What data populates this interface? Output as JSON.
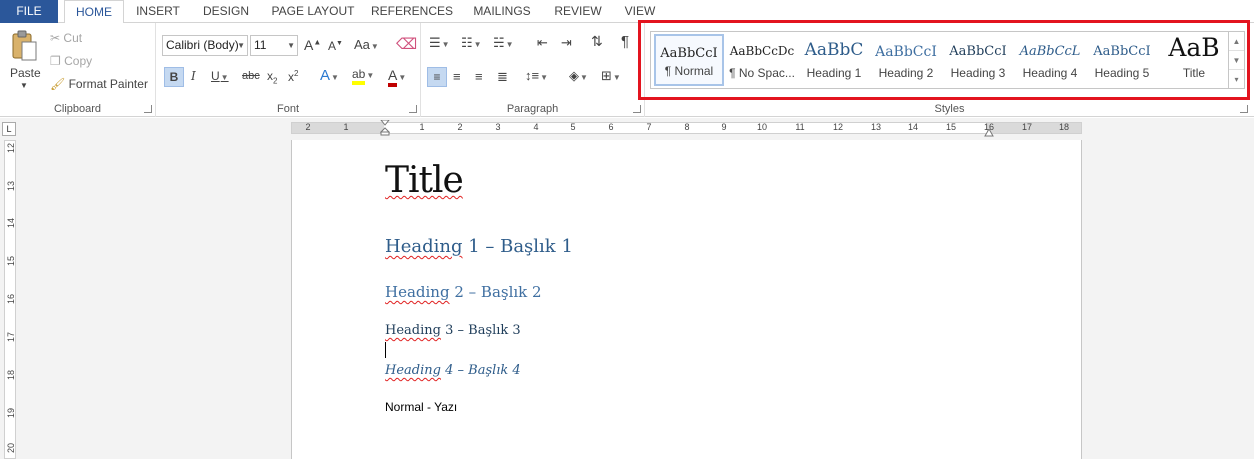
{
  "tabs": [
    {
      "label": "FILE"
    },
    {
      "label": "HOME"
    },
    {
      "label": "INSERT"
    },
    {
      "label": "DESIGN"
    },
    {
      "label": "PAGE LAYOUT"
    },
    {
      "label": "REFERENCES"
    },
    {
      "label": "MAILINGS"
    },
    {
      "label": "REVIEW"
    },
    {
      "label": "VIEW"
    }
  ],
  "clipboard": {
    "label": "Clipboard",
    "paste": "Paste",
    "cut": "Cut",
    "copy": "Copy",
    "format_painter": "Format Painter"
  },
  "font": {
    "label": "Font",
    "family": "Calibri (Body)",
    "size": "11",
    "grow": "A",
    "shrink": "A",
    "change_case": "Aa",
    "bold": "B",
    "italic": "I",
    "underline": "U",
    "strike": "abc",
    "subscript": "x",
    "superscript": "x",
    "effects": "A",
    "highlight": "ab",
    "color": "A",
    "color_hex": "#c00000",
    "highlight_hex": "#ffff00"
  },
  "paragraph": {
    "label": "Paragraph",
    "pilcrow": "¶"
  },
  "styles": {
    "label": "Styles",
    "items": [
      {
        "preview": "AaBbCcI",
        "name": "¶ Normal"
      },
      {
        "preview": "AaBbCcDc",
        "name": "¶ No Spac..."
      },
      {
        "preview": "AaBbC",
        "name": "Heading 1"
      },
      {
        "preview": "AaBbCcI",
        "name": "Heading 2"
      },
      {
        "preview": "AaBbCcI",
        "name": "Heading 3"
      },
      {
        "preview": "AaBbCcL",
        "name": "Heading 4"
      },
      {
        "preview": "AaBbCcI",
        "name": "Heading 5"
      },
      {
        "preview": "AaB",
        "name": "Title"
      }
    ]
  },
  "ruler": {
    "h_labels": [
      "2",
      "1",
      "1",
      "2",
      "3",
      "4",
      "5",
      "6",
      "7",
      "8",
      "9",
      "10",
      "11",
      "12",
      "13",
      "14",
      "15",
      "16",
      "17",
      "18"
    ],
    "v_labels": [
      "12",
      "13",
      "14",
      "15",
      "16",
      "17",
      "18",
      "19",
      "20"
    ],
    "corner": "L"
  },
  "document": {
    "title": "Title",
    "h1": "Heading 1 – Başlık 1",
    "h2": "Heading 2 – Başlık 2",
    "h3": "Heading 3 – Başlık 3",
    "h4": "Heading 4 – Başlık 4",
    "normal": "Normal - Yazı"
  }
}
